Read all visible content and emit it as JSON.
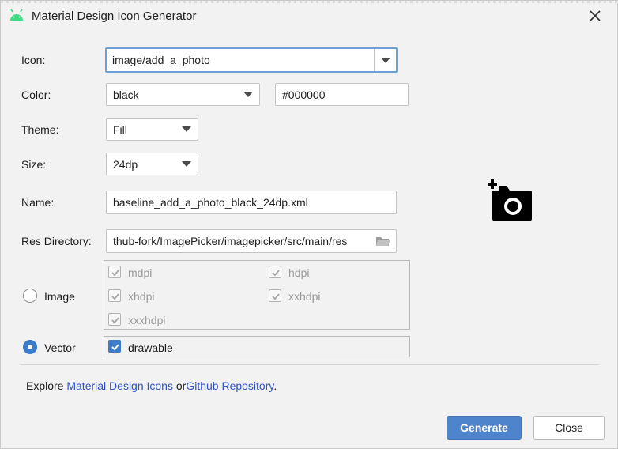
{
  "window": {
    "title": "Material Design Icon Generator"
  },
  "form": {
    "icon_label": "Icon:",
    "icon_value": "image/add_a_photo",
    "color_label": "Color:",
    "color_value": "black",
    "color_hex": "#000000",
    "theme_label": "Theme:",
    "theme_value": "Fill",
    "size_label": "Size:",
    "size_value": "24dp",
    "name_label": "Name:",
    "name_value": "baseline_add_a_photo_black_24dp.xml",
    "res_label": "Res Directory:",
    "res_value": "thub-fork/ImagePicker/imagepicker/src/main/res"
  },
  "output": {
    "image_label": "Image",
    "vector_label": "Vector",
    "selected": "Vector",
    "densities": [
      {
        "label": "mdpi",
        "checked": true,
        "enabled": false
      },
      {
        "label": "hdpi",
        "checked": true,
        "enabled": false
      },
      {
        "label": "xhdpi",
        "checked": true,
        "enabled": false
      },
      {
        "label": "xxhdpi",
        "checked": true,
        "enabled": false
      },
      {
        "label": "xxxhdpi",
        "checked": true,
        "enabled": false
      }
    ],
    "drawable": {
      "label": "drawable",
      "checked": true
    }
  },
  "footer": {
    "explore_prefix": "Explore",
    "link_icons": "Material Design Icons",
    "or_text": "or",
    "link_repo": "Github Repository",
    "period": "."
  },
  "buttons": {
    "generate": "Generate",
    "close": "Close"
  },
  "colors": {
    "accent": "#4d84cb",
    "link": "#2e52c8",
    "android_green": "#3ddc84",
    "focus_border": "#6d9fd6"
  },
  "icons": {
    "app": "android-icon",
    "window_close": "close-icon",
    "dropdown": "chevron-down-icon",
    "folder": "folder-icon",
    "preview": "add-a-photo-icon"
  }
}
